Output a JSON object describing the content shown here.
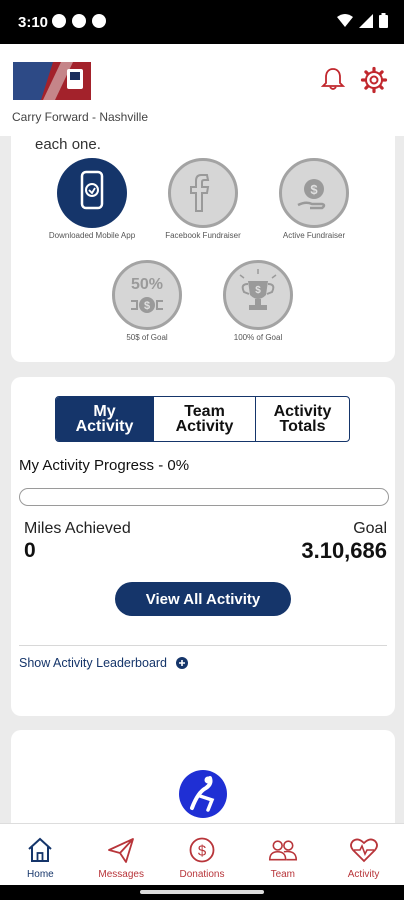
{
  "status_bar": {
    "time": "3:10"
  },
  "header": {
    "team_name": "Carry Forward - Nashville"
  },
  "achievements": {
    "intro_text": "each one.",
    "badges": [
      {
        "label": "Downloaded Mobile App",
        "icon": "mobile-app-icon",
        "earned": true
      },
      {
        "label": "Facebook Fundraiser",
        "icon": "facebook-icon",
        "earned": false
      },
      {
        "label": "Active Fundraiser",
        "icon": "dollar-hand-icon",
        "earned": false
      },
      {
        "label": "50$ of Goal",
        "icon": "fifty-percent-icon",
        "earned": false
      },
      {
        "label": "100% of Goal",
        "icon": "trophy-icon",
        "earned": false
      }
    ],
    "fifty_text": "50%"
  },
  "activity": {
    "tabs": [
      {
        "label": "My Activity",
        "active": true
      },
      {
        "label": "Team Activity",
        "active": false
      },
      {
        "label": "Activity Totals",
        "active": false
      }
    ],
    "progress_label": "My Activity Progress - 0%",
    "progress_fraction": 0,
    "miles_label": "Miles Achieved",
    "miles_value": "0",
    "goal_label": "Goal",
    "goal_value": "3.10,686",
    "view_all_label": "View All Activity",
    "leaderboard_label": "Show Activity Leaderboard"
  },
  "bottom_nav": [
    {
      "label": "Home",
      "icon": "home-icon",
      "active": true
    },
    {
      "label": "Messages",
      "icon": "paper-plane-icon",
      "active": false
    },
    {
      "label": "Donations",
      "icon": "dollar-circle-icon",
      "active": false
    },
    {
      "label": "Team",
      "icon": "people-icon",
      "active": false
    },
    {
      "label": "Activity",
      "icon": "heartbeat-icon",
      "active": false
    }
  ],
  "colors": {
    "navy": "#15356a",
    "red": "#b8353a",
    "badge_gray": "#d6d6d6"
  }
}
